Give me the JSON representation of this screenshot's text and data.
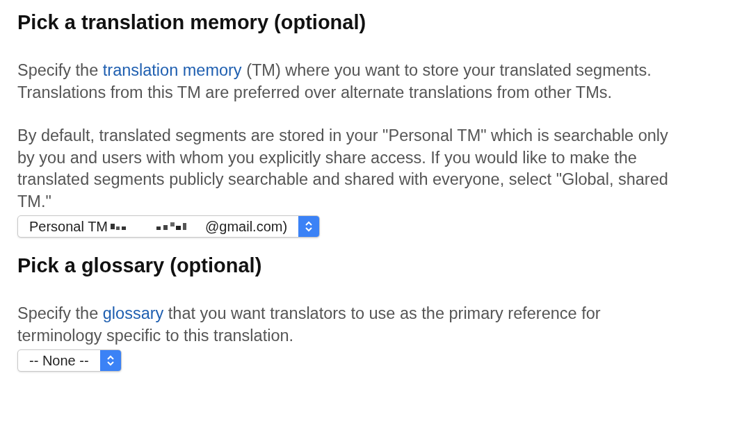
{
  "sections": [
    {
      "heading": "Pick a translation memory (optional)",
      "paragraphs": [
        {
          "before": "Specify the ",
          "link": "translation memory",
          "after": " (TM) where you want to store your translated segments. Translations from this TM are preferred over alternate translations from other TMs."
        },
        {
          "before": "By default, translated segments are stored in your \"Personal TM\" which is searchable only by you and users with whom you explicitly share access. If you would like to make the translated segments publicly searchable and shared with everyone, select \"Global, shared TM.\""
        }
      ],
      "select": {
        "value_start": "Personal TM",
        "redacted": true,
        "value_end": "@gmail.com)"
      }
    },
    {
      "heading": "Pick a glossary (optional)",
      "paragraphs": [
        {
          "before": "Specify the ",
          "link": "glossary",
          "after": " that you want translators to use as the primary reference for terminology specific to this translation."
        }
      ],
      "select": {
        "value_start": "-- None --"
      }
    }
  ]
}
